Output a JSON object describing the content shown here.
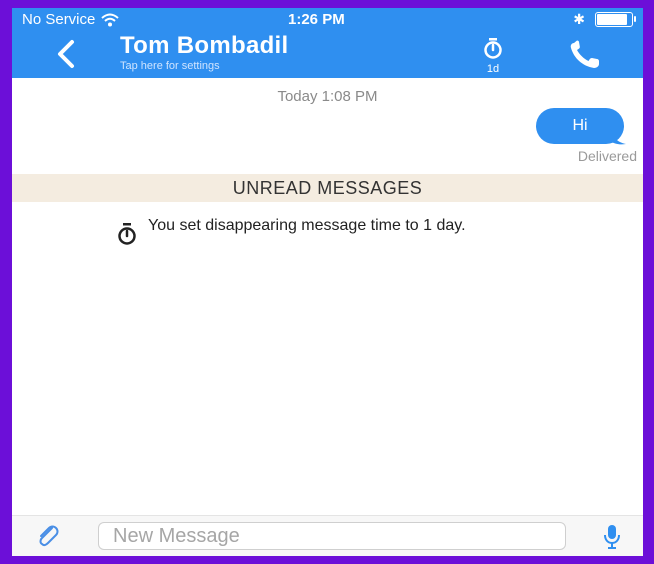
{
  "status_bar": {
    "carrier": "No Service",
    "time": "1:26 PM",
    "bluetooth": "✱"
  },
  "header": {
    "contact_name": "Tom Bombadil",
    "subtitle": "Tap here for settings",
    "timer_label": "1d"
  },
  "conversation": {
    "date_label": "Today 1:08 PM",
    "outgoing_message": "Hi",
    "delivery_status": "Delivered",
    "unread_banner": "UNREAD MESSAGES",
    "system_message": "You set disappearing message time to 1 day."
  },
  "composer": {
    "placeholder": "New Message"
  },
  "colors": {
    "accent": "#2f8ff0",
    "unread_bg": "#f4ece0",
    "frame": "#6c0fd8"
  }
}
